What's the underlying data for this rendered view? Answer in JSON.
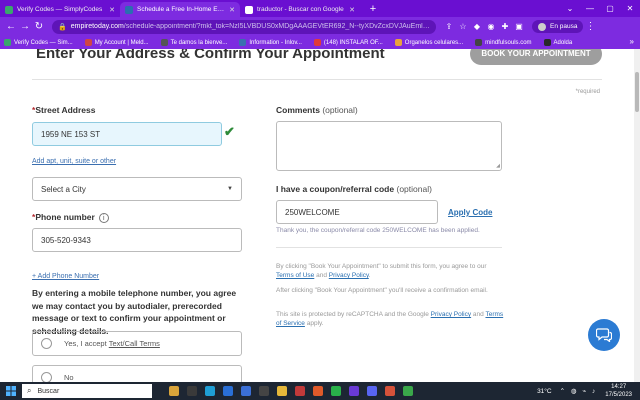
{
  "browser": {
    "tabs": [
      {
        "label": "Verify Codes — SimplyCodes",
        "color": "#3aa76d",
        "active": false
      },
      {
        "label": "Schedule a Free In-Home Estimate",
        "color": "#2a6fb0",
        "active": true
      },
      {
        "label": "traductor - Buscar con Google",
        "color": "#ffffff",
        "active": false
      }
    ],
    "url_domain": "empiretoday.com",
    "url_path": "/schedule-appointment/?mkt_tok=NzI5LVBDUS0xMDgAAAGEVtER692_N--tyXDvZcxDVJAuEmlBHYmPqZOPTZ...",
    "pause_label": "En pausa",
    "bookmarks": [
      {
        "label": "Verify Codes — Sim...",
        "color": "#3aa76d"
      },
      {
        "label": "My Account | Meld...",
        "color": "#d04545"
      },
      {
        "label": "Te damos la bienve...",
        "color": "#555555"
      },
      {
        "label": "Information - Inlov...",
        "color": "#3b6fb0"
      },
      {
        "label": "(148) INSTALAR OF...",
        "color": "#e03a3a"
      },
      {
        "label": "Organelos celulares...",
        "color": "#e9a23b"
      },
      {
        "label": "mindfulsouls.com",
        "color": "#444444"
      },
      {
        "label": "Adolda",
        "color": "#2a2a2a"
      }
    ]
  },
  "page": {
    "heading": "Enter Your Address & Confirm Your Appointment",
    "book_button": "BOOK YOUR APPOINTMENT",
    "required_note": "*required",
    "street_label": "Street Address",
    "street_value": "1959 NE 153 ST",
    "add_apt_link": "Add apt, unit, suite or other",
    "city_placeholder": "Select a City",
    "phone_label": "Phone number",
    "phone_value": "305-520-9343",
    "add_phone_link": "+ Add Phone Number",
    "consent_text": "By entering a mobile telephone number, you agree we may contact you by autodialer, prerecorded message or text to confirm your appointment or scheduling details.",
    "yes_prefix": "Yes, I accept",
    "yes_link": "Text/Call Terms",
    "no_label": "No",
    "comments_label": "Comments",
    "comments_optional": "(optional)",
    "coupon_label": "I have a coupon/referral code",
    "coupon_optional": "(optional)",
    "coupon_value": "250WELCOME",
    "apply_label": "Apply Code",
    "coupon_note": "Thank you, the coupon/referral code 250WELCOME has been applied.",
    "fine1_a": "By clicking \"Book Your Appointment\" to submit this form, you agree to our",
    "fine1_terms": "Terms of Use",
    "fine1_and": "and",
    "fine1_privacy": "Privacy Policy",
    "fine1_end": ".",
    "fine2": "After clicking \"Book Your Appointment\" you'll receive a confirmation email.",
    "fine3_a": "This site is protected by reCAPTCHA and the Google",
    "fine3_privacy": "Privacy Policy",
    "fine3_and": "and",
    "fine3_terms": "Terms of Service",
    "fine3_end": "apply."
  },
  "taskbar": {
    "search_label": "Buscar",
    "weather": "31°C",
    "time": "14:27",
    "date": "17/5/2023",
    "apps": [
      {
        "name": "files-app",
        "color": "#d9a43a"
      },
      {
        "name": "calc-app",
        "color": "#3a3a3a"
      },
      {
        "name": "edge-app",
        "color": "#1f9fd6"
      },
      {
        "name": "mail-app",
        "color": "#2a6fd6"
      },
      {
        "name": "store-app",
        "color": "#3b6fd6"
      },
      {
        "name": "terminal-app",
        "color": "#444444"
      },
      {
        "name": "explorer-app",
        "color": "#e6b83a"
      },
      {
        "name": "mixed-app",
        "color": "#c23a3a"
      },
      {
        "name": "brave-app",
        "color": "#e05a2a"
      },
      {
        "name": "whatsapp-app",
        "color": "#29b24a"
      },
      {
        "name": "chat-app",
        "color": "#6a3ad6"
      },
      {
        "name": "discord-app",
        "color": "#5865f2"
      },
      {
        "name": "photos-app",
        "color": "#d6523a"
      },
      {
        "name": "chrome-app",
        "color": "#3aa84a"
      }
    ]
  }
}
